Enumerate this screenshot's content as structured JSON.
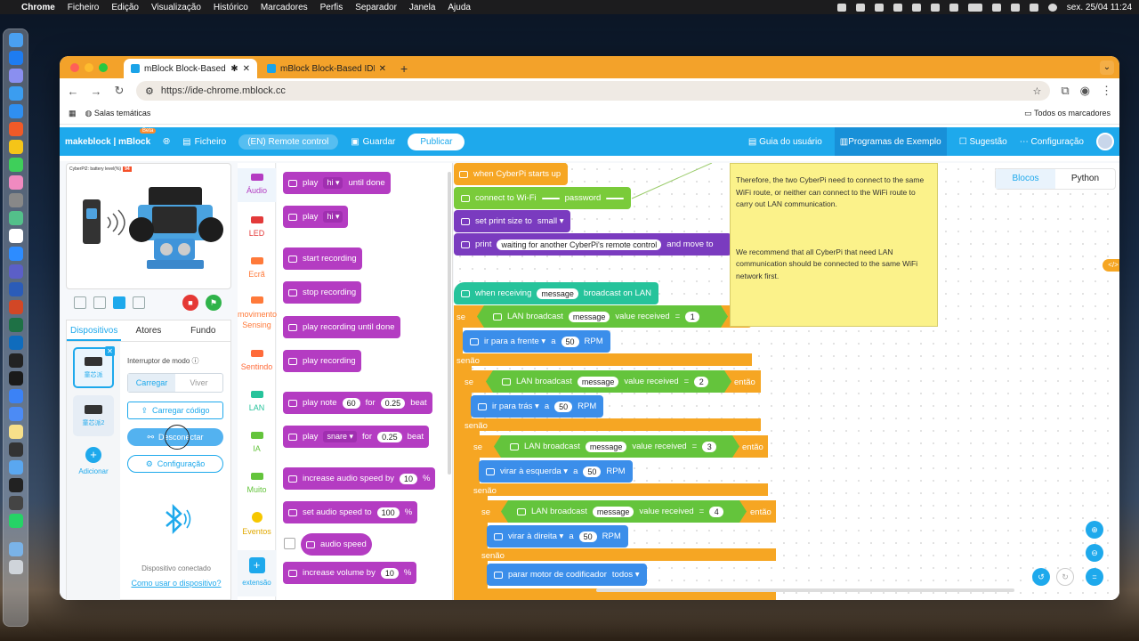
{
  "menubar": {
    "app": "Chrome",
    "items": [
      "Ficheiro",
      "Edição",
      "Visualização",
      "Histórico",
      "Marcadores",
      "Perfis",
      "Separador",
      "Janela",
      "Ajuda"
    ],
    "datetime": "sex. 25/04  11:24"
  },
  "browser": {
    "tabs": [
      {
        "title": "mBlock Block-Based IDE- "
      },
      {
        "title": "mBlock Block-Based IDE- Co"
      }
    ],
    "url": "https://ide-chrome.mblock.cc",
    "bookmark": "Salas temáticas",
    "all_bookmarks": "Todos os marcadores"
  },
  "app": {
    "logo": "makeblock | mBlock",
    "beta": "Beta",
    "file": "Ficheiro",
    "project": "(EN) Remote control",
    "save": "Guardar",
    "publish": "Publicar",
    "right": [
      "Guia do usuário",
      "Programas de Exemplo",
      "Sugestão",
      "Configuração"
    ]
  },
  "stage": {
    "label": "CyberPi2: battery level(%)",
    "badge": "94"
  },
  "devices": {
    "tabs": [
      "Dispositivos",
      "Atores",
      "Fundo"
    ],
    "cards": [
      "童芯派",
      "童芯派2"
    ],
    "add": "Adicionar",
    "mode_label": "Interruptor de modo",
    "mode": [
      "Carregar",
      "Viver"
    ],
    "upload": "Carregar código",
    "disconnect": "Desconectar",
    "config": "Configuração",
    "state": "Dispositivo conectado",
    "howto": "Como usar o dispositivo?"
  },
  "categories": [
    {
      "label": "Áudio",
      "color": "#b43cc2"
    },
    {
      "label": "LED",
      "color": "#e33a3a"
    },
    {
      "label": "Ecrã",
      "color": "#ff7a3a"
    },
    {
      "label": "movimento Sensing",
      "color": "#ff7a3a"
    },
    {
      "label": "Sentindo",
      "color": "#ff6b3a"
    },
    {
      "label": "LAN",
      "color": "#26c39b"
    },
    {
      "label": "IA",
      "color": "#64c43c"
    },
    {
      "label": "Muito",
      "color": "#64c43c"
    },
    {
      "label": "Eventos",
      "color": "#f6c700"
    }
  ],
  "extension": "extensão",
  "palette": {
    "b1": {
      "a": "play",
      "b": "hi",
      "c": "until done"
    },
    "b2": {
      "a": "play",
      "b": "hi"
    },
    "b3": "start recording",
    "b4": "stop recording",
    "b5": "play recording until done",
    "b6": "play recording",
    "b7": {
      "a": "play note",
      "b": "60",
      "c": "for",
      "d": "0.25",
      "e": "beat"
    },
    "b8": {
      "a": "play",
      "b": "snare",
      "c": "for",
      "d": "0.25",
      "e": "beat"
    },
    "b9": {
      "a": "increase audio speed by",
      "b": "10",
      "c": "%"
    },
    "b10": {
      "a": "set audio speed to",
      "b": "100",
      "c": "%"
    },
    "b11": "audio speed",
    "b12": {
      "a": "increase volume by",
      "b": "10",
      "c": "%"
    }
  },
  "code": {
    "start": "when CyberPi starts up",
    "wifi": {
      "a": "connect to Wi-Fi",
      "b": "password"
    },
    "print_size": {
      "a": "set print size to",
      "b": "small"
    },
    "print": {
      "a": "print",
      "b": "waiting for another CyberPi's remote control",
      "c": "and move to"
    },
    "recv": {
      "a": "when receiving",
      "b": "message",
      "c": "broadcast on LAN"
    },
    "se": "se",
    "senao": "senão",
    "entao": "então",
    "lan": "LAN broadcast",
    "msg": "message",
    "vr": "value received",
    "eq": "=",
    "v1": "1",
    "v2": "2",
    "v3": "3",
    "v4": "4",
    "m1": {
      "a": "ir para a frente",
      "b": "a",
      "c": "50",
      "d": "RPM"
    },
    "m2": {
      "a": "ir para trás",
      "b": "a",
      "c": "50",
      "d": "RPM"
    },
    "m3": {
      "a": "virar à esquerda",
      "b": "a",
      "c": "50",
      "d": "RPM"
    },
    "m4": {
      "a": "virar à direita",
      "b": "a",
      "c": "50",
      "d": "RPM"
    },
    "stop": {
      "a": "parar motor de codificador",
      "b": "todos"
    }
  },
  "note": {
    "p1": "Therefore, the two CyberPi need to connect to the same WiFi route, or neither can connect to the WiFi route to carry out LAN communication.",
    "p2": "We recommend that all CyberPi that need LAN communication should be connected to the same WiFi network first."
  },
  "code_tabs": [
    "Blocos",
    "Python"
  ],
  "code_fab": "</>"
}
